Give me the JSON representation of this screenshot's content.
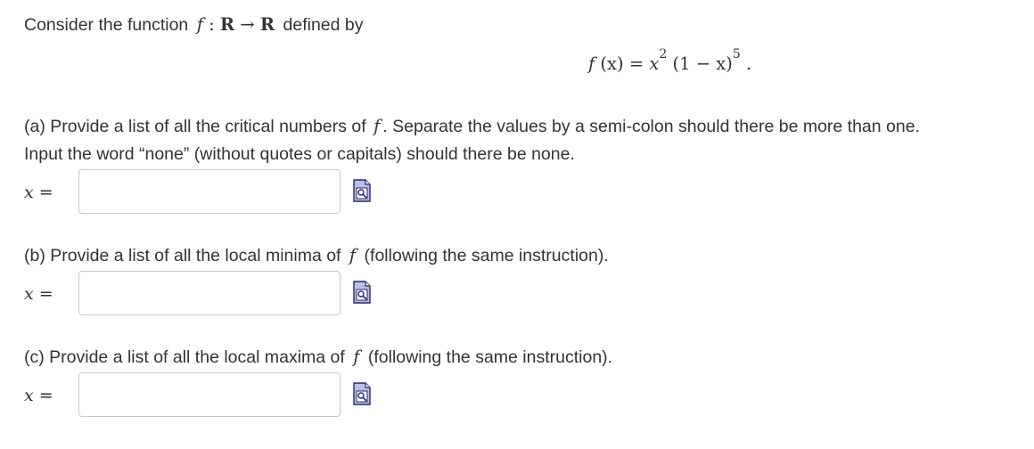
{
  "intro": {
    "text_before": "Consider the function",
    "f": "f",
    "colon": " : ",
    "domain": "R",
    "arrow": " → ",
    "codomain": "R",
    "text_after": "defined by"
  },
  "formula": {
    "f": "f",
    "arg": " (x) = ",
    "x": "x",
    "exp1": "2",
    "factor": " (1 − x)",
    "exp2": "5",
    "end": " ."
  },
  "part_a": {
    "line1_before": "(a) Provide a list of all the critical numbers of",
    "f": "f",
    "line1_after": ". Separate the values by a semi-colon should there be more than one.",
    "line2": "Input the word “none” (without quotes or capitals) should there be none.",
    "label": "x =",
    "value": ""
  },
  "part_b": {
    "text_before": "(b) Provide a list of all the local minima of",
    "f": "f",
    "text_after": "(following the same instruction).",
    "label": "x =",
    "value": ""
  },
  "part_c": {
    "text_before": "(c) Provide a list of all the local maxima of",
    "f": "f",
    "text_after": "(following the same instruction).",
    "label": "x =",
    "value": ""
  },
  "icons": {
    "preview": "preview-icon"
  },
  "colors": {
    "text": "#333333",
    "field_border": "#c8c8c8",
    "icon_fill": "#b8bfe8",
    "icon_stroke": "#2a2a6a"
  }
}
